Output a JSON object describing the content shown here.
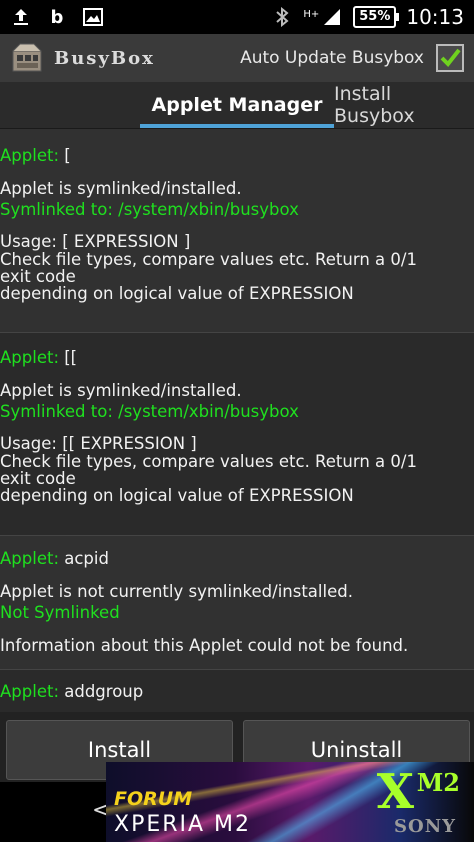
{
  "status_bar": {
    "icons_left": [
      "upload-icon",
      "b-icon",
      "image-icon"
    ],
    "b_letter": "b",
    "icons_right": [
      "bluetooth-icon",
      "signal-icon"
    ],
    "network_label": "H+",
    "battery": "55%",
    "time": "10:13"
  },
  "action_bar": {
    "title": "BusyBox",
    "auto_update_label": "Auto Update Busybox",
    "auto_update_checked": true
  },
  "tabs": [
    {
      "label": "Applet Manager",
      "active": true
    },
    {
      "label": "Install Busybox",
      "active": false
    }
  ],
  "applets": [
    {
      "prefix": "Applet: ",
      "name": "[",
      "status": "Applet is symlinked/installed.",
      "link": "Symlinked to: /system/xbin/busybox",
      "usage": "Usage: [ EXPRESSION ]",
      "desc1": "Check file types, compare values etc. Return a 0/1",
      "desc2": "exit code",
      "desc3": "depending on logical value of EXPRESSION"
    },
    {
      "prefix": "Applet: ",
      "name": "[[",
      "status": "Applet is symlinked/installed.",
      "link": "Symlinked to: /system/xbin/busybox",
      "usage": "Usage: [[ EXPRESSION ]",
      "desc1": "Check file types, compare values etc. Return a 0/1",
      "desc2": "exit code",
      "desc3": "depending on logical value of EXPRESSION"
    },
    {
      "prefix": "Applet: ",
      "name": "acpid",
      "status": "Applet is not currently symlinked/installed.",
      "link": "Not Symlinked",
      "info": "Information about this Applet could not be found."
    },
    {
      "prefix": "Applet: ",
      "name": "addgroup"
    }
  ],
  "buttons": {
    "install": "Install",
    "uninstall": "Uninstall"
  },
  "banner": {
    "forum": "FORUM",
    "xperia": "XPERIA M2",
    "xm_logo": "X",
    "m2_logo": "M2",
    "sony": "SONY",
    "back_glyph": "<"
  },
  "colors": {
    "accent": "#4fa3d8",
    "green_text": "#1fe01f",
    "background": "#2a2a2a"
  }
}
